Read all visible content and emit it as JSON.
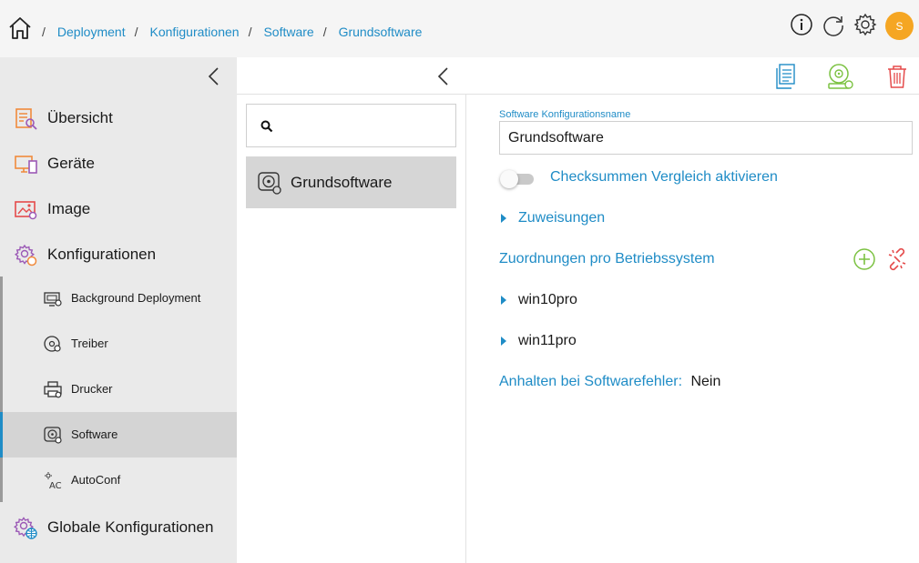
{
  "breadcrumb": {
    "separator": "/",
    "items": [
      "Deployment",
      "Konfigurationen",
      "Software",
      "Grundsoftware"
    ]
  },
  "header": {
    "avatar_initial": "S",
    "icons": [
      "info-icon",
      "refresh-icon",
      "gear-icon"
    ]
  },
  "sidebar": {
    "items": [
      {
        "label": "Übersicht",
        "icon": "overview-icon"
      },
      {
        "label": "Geräte",
        "icon": "devices-icon"
      },
      {
        "label": "Image",
        "icon": "image-icon"
      },
      {
        "label": "Konfigurationen",
        "icon": "configurations-icon"
      }
    ],
    "subitems": [
      {
        "label": "Background Deployment",
        "icon": "background-deployment-icon"
      },
      {
        "label": "Treiber",
        "icon": "driver-icon"
      },
      {
        "label": "Drucker",
        "icon": "printer-icon"
      },
      {
        "label": "Software",
        "icon": "software-icon",
        "active": true
      },
      {
        "label": "AutoConf",
        "icon": "autoconf-icon"
      }
    ],
    "bottom_item": {
      "label": "Globale Konfigurationen",
      "icon": "global-config-icon"
    }
  },
  "search": {
    "value": "",
    "placeholder": ""
  },
  "list": {
    "items": [
      {
        "label": "Grundsoftware",
        "selected": true
      }
    ]
  },
  "detail": {
    "name_label": "Software Konfigurationsname",
    "name_value": "Grundsoftware",
    "checksum_toggle_label": "Checksummen Vergleich aktivieren",
    "checksum_enabled": false,
    "assignments_label": "Zuweisungen",
    "os_mapping_title": "Zuordnungen pro Betriebssystem",
    "os_items": [
      "win10pro",
      "win11pro"
    ],
    "halt_label": "Anhalten bei Softwarefehler:",
    "halt_value": "Nein"
  },
  "colors": {
    "accent": "#1f8cc6",
    "avatar": "#f5a623",
    "orange_icon": "#f08a3c",
    "green_icon": "#7cc242",
    "red_icon": "#e54b4b",
    "purple_icon": "#9b59b6",
    "sidebar_bg": "#eaeaea",
    "selected_bg": "#d6d6d6"
  }
}
